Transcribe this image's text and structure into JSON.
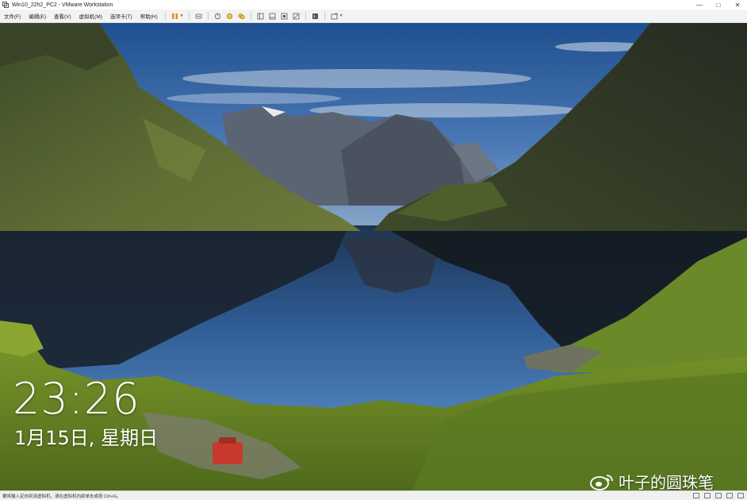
{
  "window": {
    "title": "Win10_22h2_PC2 - VMware Workstation",
    "controls": {
      "minimize": "—",
      "maximize": "□",
      "close": "✕"
    }
  },
  "menu": {
    "items": [
      "文件(F)",
      "编辑(E)",
      "查看(V)",
      "虚拟机(M)",
      "选项卡(T)",
      "帮助(H)"
    ]
  },
  "toolbar": {
    "icons": [
      "pause-icon",
      "send-keys-icon",
      "snapshot-icon",
      "revert-snapshot-icon",
      "snapshot-manager-icon",
      "sidebar-icon",
      "thumbnail-icon",
      "fullscreen-icon",
      "unity-icon",
      "console-icon",
      "stretch-icon"
    ]
  },
  "lockscreen": {
    "time": "23:26",
    "date": "1月15日, 星期日"
  },
  "watermark": {
    "text": "叶子的圆珠笔",
    "logo": "weibo-logo"
  },
  "statusbar": {
    "text": "要将输入定向到该虚拟机，请在虚拟机内部单击或按 Ctrl+G。"
  },
  "colors": {
    "pause_accent": "#e38b1b",
    "sky": "#3d6aa6",
    "grass": "#7e9a2b"
  }
}
